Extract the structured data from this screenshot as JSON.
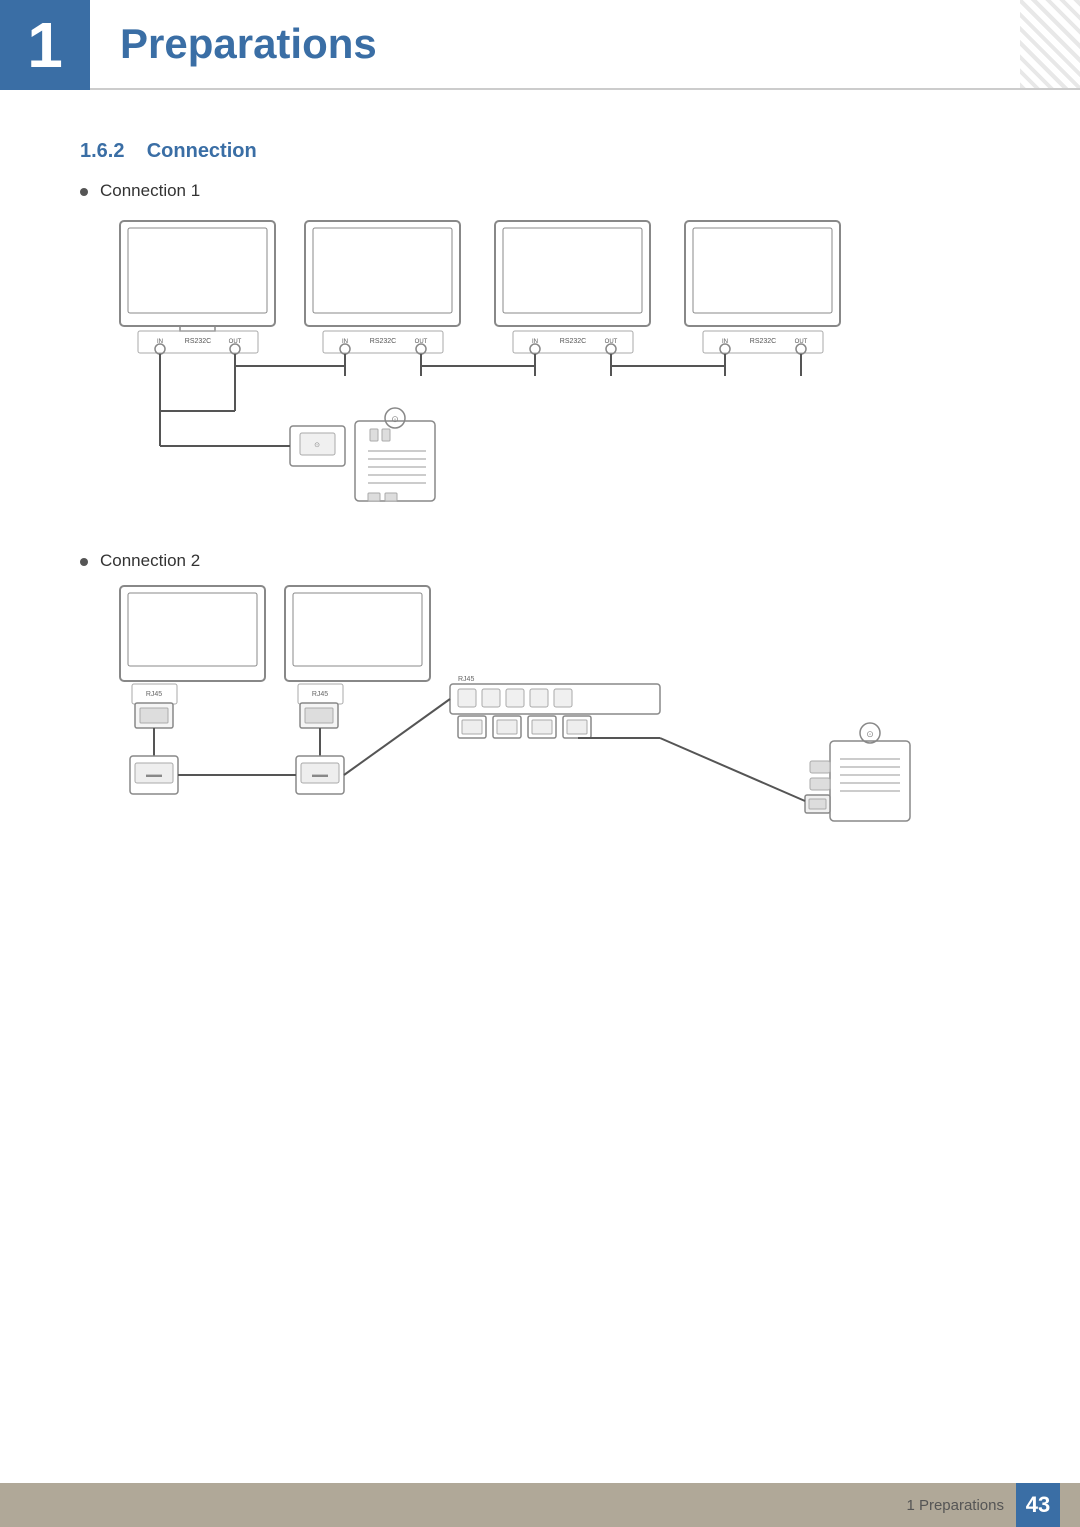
{
  "header": {
    "chapter_number": "1",
    "title": "Preparations"
  },
  "section": {
    "number": "1.6.2",
    "title": "Connection"
  },
  "connections": [
    {
      "label": "Connection 1"
    },
    {
      "label": "Connection 2"
    }
  ],
  "footer": {
    "text": "1 Preparations",
    "page_number": "43"
  }
}
